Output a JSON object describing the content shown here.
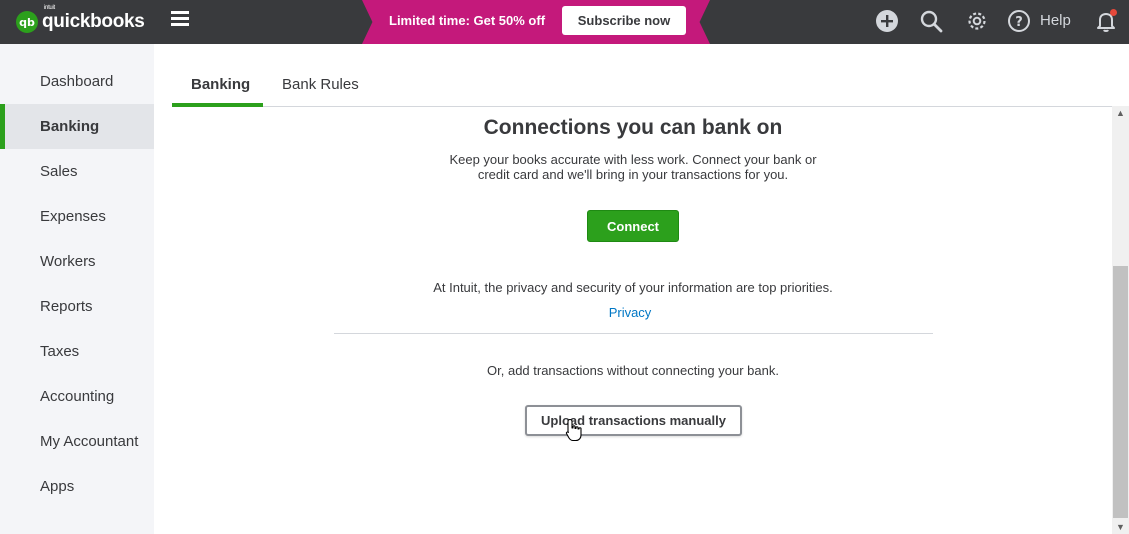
{
  "brand": {
    "name": "quickbooks",
    "badge": "qb",
    "maker": "intuit"
  },
  "promo": {
    "text": "Limited time: Get 50% off",
    "button": "Subscribe now",
    "color": "#c4197b"
  },
  "topbar": {
    "help_label": "Help",
    "icons": [
      "plus-icon",
      "search-icon",
      "gear-icon",
      "help-icon",
      "bell-icon"
    ]
  },
  "sidebar": {
    "items": [
      {
        "label": "Dashboard"
      },
      {
        "label": "Banking",
        "active": true
      },
      {
        "label": "Sales"
      },
      {
        "label": "Expenses"
      },
      {
        "label": "Workers"
      },
      {
        "label": "Reports"
      },
      {
        "label": "Taxes"
      },
      {
        "label": "Accounting"
      },
      {
        "label": "My Accountant"
      },
      {
        "label": "Apps"
      }
    ]
  },
  "tabs": [
    {
      "label": "Banking",
      "active": true
    },
    {
      "label": "Bank Rules"
    }
  ],
  "content": {
    "heading": "Connections you can bank on",
    "lead": "Keep your books accurate with less work. Connect your bank or credit card and we'll bring in your transactions for you.",
    "connect_button": "Connect",
    "privacy_note": "At Intuit, the privacy and security of your information are top priorities.",
    "privacy_link": "Privacy",
    "alt_note": "Or, add transactions without connecting your bank.",
    "upload_button": "Upload transactions manually"
  },
  "colors": {
    "accent": "#2ca01c",
    "topbar": "#393a3d",
    "link": "#0077c5"
  }
}
